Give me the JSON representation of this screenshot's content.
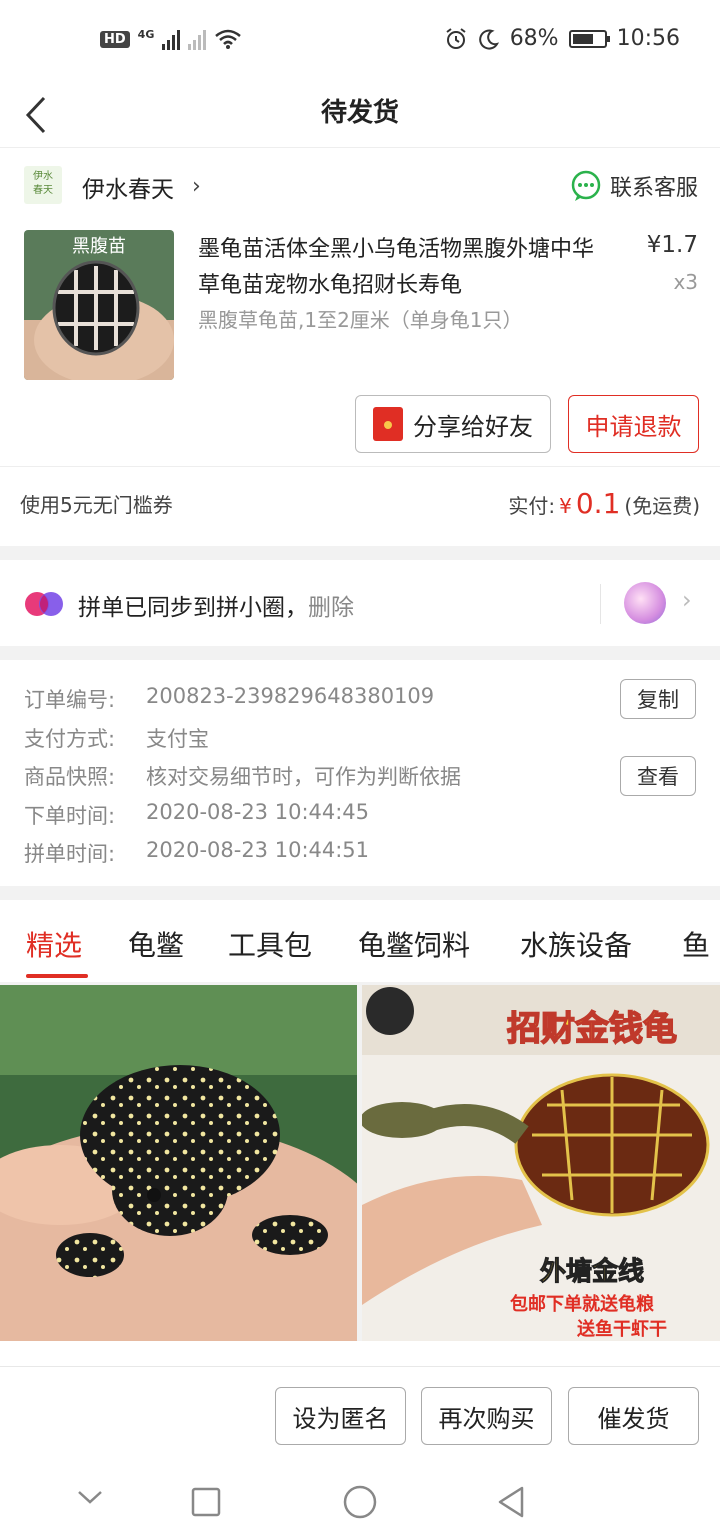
{
  "status_bar": {
    "network": "4G",
    "battery": "68%",
    "battery_level": 0.68,
    "time": "10:56",
    "hd_label": "HD"
  },
  "header": {
    "title": "待发货"
  },
  "shop": {
    "logo_text": "伊水\n春天",
    "name": "伊水春天",
    "contact_label": "联系客服"
  },
  "product": {
    "image_text": "黑腹苗",
    "title": "墨龟苗活体全黑小乌龟活物黑腹外塘中华草龟苗宠物水龟招财长寿龟",
    "price": "¥1.7",
    "quantity": "x3",
    "spec": "黑腹草龟苗,1至2厘米（单身龟1只）"
  },
  "actions": {
    "share_label": "分享给好友",
    "refund_label": "申请退款"
  },
  "payment": {
    "coupon": "使用5元无门槛券",
    "paid_label": "实付:",
    "currency": "¥",
    "amount": "0.1",
    "shipping_note": "(免运费)"
  },
  "sync": {
    "text": "拼单已同步到拼小圈，",
    "delete_label": "删除"
  },
  "order_info": {
    "rows": [
      {
        "label": "订单编号:",
        "value": "200823-239829648380109"
      },
      {
        "label": "支付方式:",
        "value": "支付宝"
      },
      {
        "label": "商品快照:",
        "value": "核对交易细节时，可作为判断依据"
      },
      {
        "label": "下单时间:",
        "value": "2020-08-23 10:44:45"
      },
      {
        "label": "拼单时间:",
        "value": "2020-08-23 10:44:51"
      }
    ],
    "copy_label": "复制",
    "view_label": "查看"
  },
  "tabs": [
    "精选",
    "龟鳖",
    "工具包",
    "龟鳖饲料",
    "水族设备",
    "鱼"
  ],
  "grid": {
    "right_banner": "招财金钱龟",
    "right_line1": "外塘金线",
    "right_line2": "包邮下单就送龟粮",
    "right_line3": "送鱼干虾干"
  },
  "bottom_actions": {
    "anonymous_label": "设为匿名",
    "rebuy_label": "再次购买",
    "urge_label": "催发货"
  },
  "colors": {
    "accent": "#e02e24",
    "wechat_green": "#2bb24c"
  }
}
